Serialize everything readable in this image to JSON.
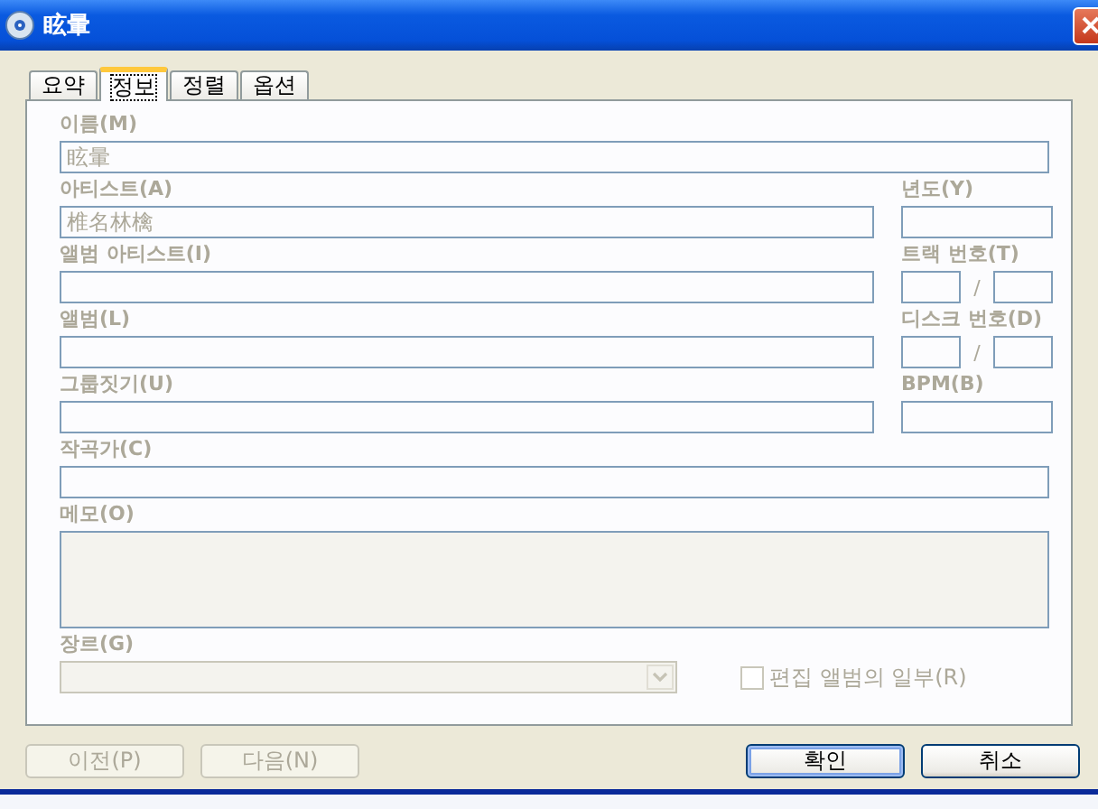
{
  "window": {
    "title": "眩暈"
  },
  "tabs": [
    {
      "label": "요약",
      "selected": false
    },
    {
      "label": "정보",
      "selected": true
    },
    {
      "label": "정렬",
      "selected": false
    },
    {
      "label": "옵션",
      "selected": false
    }
  ],
  "rows": [
    {
      "fields": [
        {
          "kind": "text",
          "label": "이름(M)",
          "value": "眩暈",
          "disabled": true
        }
      ]
    },
    {
      "fields": [
        {
          "kind": "text",
          "label": "아티스트(A)",
          "value": "椎名林檎",
          "disabled": true
        },
        {
          "kind": "text",
          "label": "년도(Y)",
          "disabled": true
        }
      ]
    },
    {
      "fields": [
        {
          "kind": "text",
          "label": "앨범 아티스트(I)",
          "disabled": true
        },
        {
          "kind": "pair",
          "label": "트랙 번호(T)",
          "separator": "/",
          "disabled": true
        }
      ]
    },
    {
      "fields": [
        {
          "kind": "text",
          "label": "앨범(L)",
          "disabled": true
        },
        {
          "kind": "pair",
          "label": "디스크 번호(D)",
          "separator": "/",
          "disabled": true
        }
      ]
    },
    {
      "fields": [
        {
          "kind": "text",
          "label": "그룹짓기(U)",
          "disabled": true
        },
        {
          "kind": "text",
          "label": "BPM(B)",
          "disabled": true
        }
      ]
    },
    {
      "fields": [
        {
          "kind": "text",
          "label": "작곡가(C)",
          "disabled": true
        }
      ]
    },
    {
      "fields": [
        {
          "kind": "memo",
          "label": "메모(O)",
          "disabled": true
        }
      ]
    },
    {
      "fields": [
        {
          "kind": "dropdown",
          "label": "장르(G)",
          "disabled": true
        },
        {
          "kind": "checkbox",
          "label": "편집 앨범의 일부(R)",
          "checked": false,
          "disabled": true
        }
      ]
    }
  ],
  "buttons": [
    {
      "label": "이전(P)",
      "disabled": true,
      "default": false
    },
    {
      "label": "다음(N)",
      "disabled": true,
      "default": false
    },
    {
      "label": "확인",
      "disabled": false,
      "default": true
    },
    {
      "label": "취소",
      "disabled": false,
      "default": false
    }
  ]
}
